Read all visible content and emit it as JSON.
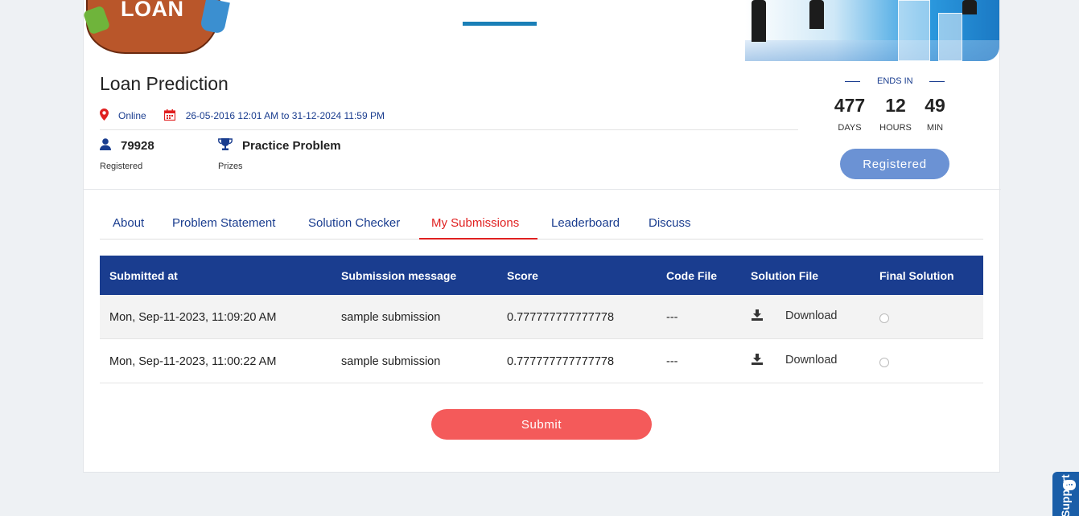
{
  "banner": {
    "logo_text": "LOAN"
  },
  "contest": {
    "title": "Loan Prediction",
    "location": "Online",
    "dates": "26-05-2016 12:01 AM to 31-12-2024 11:59 PM",
    "registered_count": "79928",
    "registered_label": "Registered",
    "prize_value": "Practice Problem",
    "prize_label": "Prizes"
  },
  "countdown": {
    "label": "ENDS IN",
    "days": "477",
    "days_unit": "DAYS",
    "hours": "12",
    "hours_unit": "HOURS",
    "minutes": "49",
    "minutes_unit": "MIN"
  },
  "register_button": "Registered",
  "tabs": [
    {
      "label": "About"
    },
    {
      "label": "Problem Statement"
    },
    {
      "label": "Solution Checker"
    },
    {
      "label": "My Submissions",
      "active": true
    },
    {
      "label": "Leaderboard"
    },
    {
      "label": "Discuss"
    }
  ],
  "table": {
    "headers": [
      "Submitted at",
      "Submission message",
      "Score",
      "Code File",
      "Solution File",
      "Final Solution"
    ],
    "rows": [
      {
        "submitted_at": "Mon, Sep-11-2023, 11:09:20 AM",
        "message": "sample submission",
        "score": "0.777777777777778",
        "code_file": "---",
        "solution_file": "Download"
      },
      {
        "submitted_at": "Mon, Sep-11-2023, 11:00:22 AM",
        "message": "sample submission",
        "score": "0.777777777777778",
        "code_file": "---",
        "solution_file": "Download"
      }
    ]
  },
  "submit_button": "Submit",
  "support": {
    "label": "Support"
  },
  "colors": {
    "primary": "#1a3d8f",
    "accent_red": "#e02020",
    "submit": "#f45a5a",
    "registered_button": "#6b92d4"
  },
  "icons": {
    "location": "map-pin-icon",
    "calendar": "calendar-icon",
    "user": "user-icon",
    "trophy": "trophy-icon",
    "download": "download-icon",
    "chat": "chat-bubble-icon"
  }
}
